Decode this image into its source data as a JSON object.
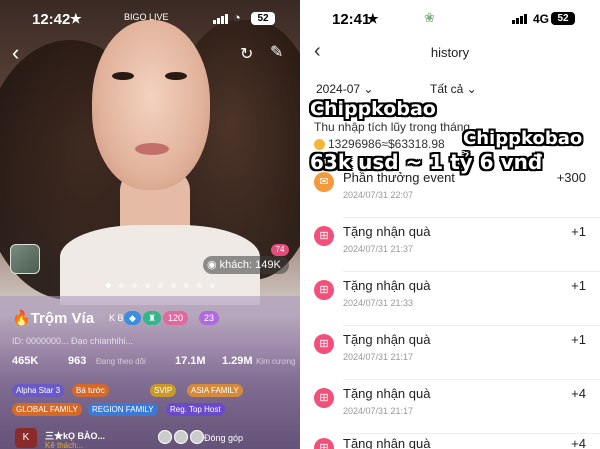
{
  "left": {
    "status": {
      "time": "12:42",
      "star": "★",
      "brand": "BIGO LIVE",
      "battery": "52"
    },
    "icons": {
      "back": "back-icon",
      "share": "share-icon",
      "edit": "edit-icon"
    },
    "viewers_badge": "khách: 149K",
    "viewers_count": "74",
    "profile": {
      "name": "🔥Trộm Vía",
      "suffix": "K B",
      "level_a": "120",
      "level_b": "23",
      "id_line": "ID: 0000000...        Đạo chianhihi...",
      "stats": [
        {
          "value": "465K",
          "label": ""
        },
        {
          "value": "963",
          "label": "Đang theo dõi"
        },
        {
          "value": "17.1M",
          "label": ""
        },
        {
          "value": "1.29M",
          "label": "Kim cương"
        }
      ],
      "tags_row1": [
        "Alpha Star 3",
        "Bá tước",
        "SVIP",
        "ASIA FAMILY"
      ],
      "tags_row2": [
        "GLOBAL FAMILY",
        "REGION FAMILY",
        "Reg. Top Host"
      ],
      "fan_avatar": "K",
      "fan_name": "三★kỌ BÀO...",
      "fan_sub": "Kê thách...",
      "contribute": "Đóng góp"
    }
  },
  "right": {
    "status": {
      "time": "12:41",
      "star": "★",
      "network": "4G",
      "battery": "52"
    },
    "title": "history",
    "filter_month": "2024-07 ⌄",
    "filter_type": "Tất cả ⌄",
    "summary_label": "Thu nhập tích lũy trong tháng",
    "summary_value": "13296986≈$63318.98",
    "rows": [
      {
        "title": "Phần thưởng event",
        "date": "2024/07/31 22:07",
        "amount": "+300",
        "icon": "event-icon"
      },
      {
        "title": "Tặng nhận quà",
        "date": "2024/07/31 21:37",
        "amount": "+1",
        "icon": "gift-icon"
      },
      {
        "title": "Tặng nhận quà",
        "date": "2024/07/31 21:33",
        "amount": "+1",
        "icon": "gift-icon"
      },
      {
        "title": "Tặng nhận quà",
        "date": "2024/07/31 21:17",
        "amount": "+1",
        "icon": "gift-icon"
      },
      {
        "title": "Tặng nhận quà",
        "date": "2024/07/31 21:17",
        "amount": "+4",
        "icon": "gift-icon"
      },
      {
        "title": "Tặng nhận quà",
        "date": "",
        "amount": "+4",
        "icon": "gift-icon"
      }
    ]
  },
  "watermarks": {
    "brand_a": "Chippkobao",
    "brand_b": "Chippkobao",
    "headline": "63k usd ~ 1 tỷ 6 vnđ"
  }
}
